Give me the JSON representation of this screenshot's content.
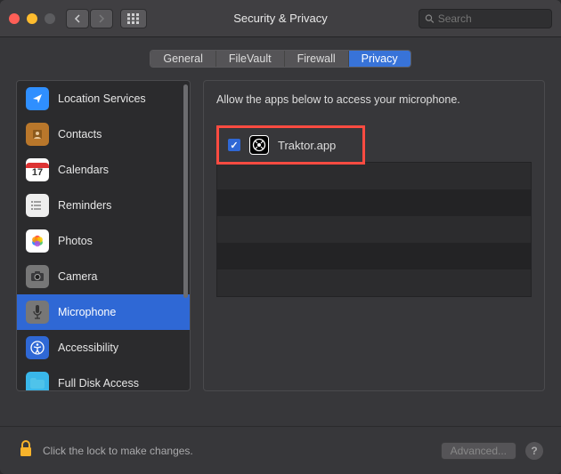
{
  "window": {
    "title": "Security & Privacy"
  },
  "search": {
    "placeholder": "Search"
  },
  "tabs": [
    {
      "label": "General",
      "active": false
    },
    {
      "label": "FileVault",
      "active": false
    },
    {
      "label": "Firewall",
      "active": false
    },
    {
      "label": "Privacy",
      "active": true
    }
  ],
  "sidebar": {
    "items": [
      {
        "label": "Location Services",
        "icon": "location-icon",
        "selected": false
      },
      {
        "label": "Contacts",
        "icon": "contacts-icon",
        "selected": false
      },
      {
        "label": "Calendars",
        "icon": "calendar-icon",
        "selected": false,
        "calendarDay": "17"
      },
      {
        "label": "Reminders",
        "icon": "reminders-icon",
        "selected": false
      },
      {
        "label": "Photos",
        "icon": "photos-icon",
        "selected": false
      },
      {
        "label": "Camera",
        "icon": "camera-icon",
        "selected": false
      },
      {
        "label": "Microphone",
        "icon": "microphone-icon",
        "selected": true
      },
      {
        "label": "Accessibility",
        "icon": "accessibility-icon",
        "selected": false
      },
      {
        "label": "Full Disk Access",
        "icon": "folder-icon",
        "selected": false
      }
    ]
  },
  "main": {
    "hint": "Allow the apps below to access your microphone.",
    "apps": [
      {
        "name": "Traktor.app",
        "checked": true,
        "highlighted": true
      }
    ]
  },
  "footer": {
    "lockText": "Click the lock to make changes.",
    "advancedLabel": "Advanced...",
    "helpLabel": "?"
  }
}
